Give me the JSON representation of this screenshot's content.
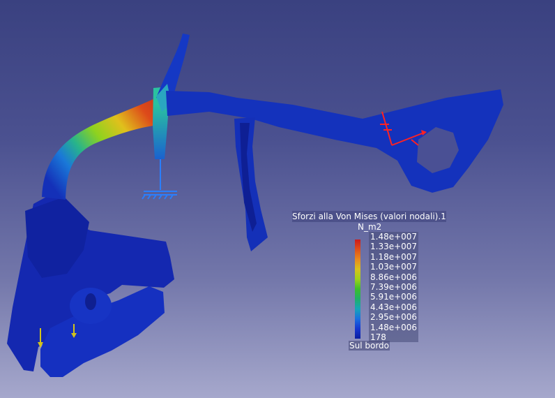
{
  "viewport": {
    "legend": {
      "title": "Sforzi alla Von Mises (valori nodali).1",
      "unit": "N_m2",
      "values": [
        "1.48e+007",
        "1.33e+007",
        "1.18e+007",
        "1.03e+007",
        "8.86e+006",
        "7.39e+006",
        "5.91e+006",
        "4.43e+006",
        "2.95e+006",
        "1.48e+006",
        "178"
      ],
      "footer": "Sul bordo"
    }
  },
  "colors": {
    "part_base": "#1428b0",
    "stress_high": "#cc1a1a",
    "stress_mid": "#3cbf2a",
    "clamp_symbol": "#2a7fff",
    "load_arrow": "#d2c31a",
    "axis_marker": "#ff2222"
  },
  "icons": [
    "clamp-restraint-icon",
    "load-arrow-icon",
    "axis-triad-icon"
  ]
}
